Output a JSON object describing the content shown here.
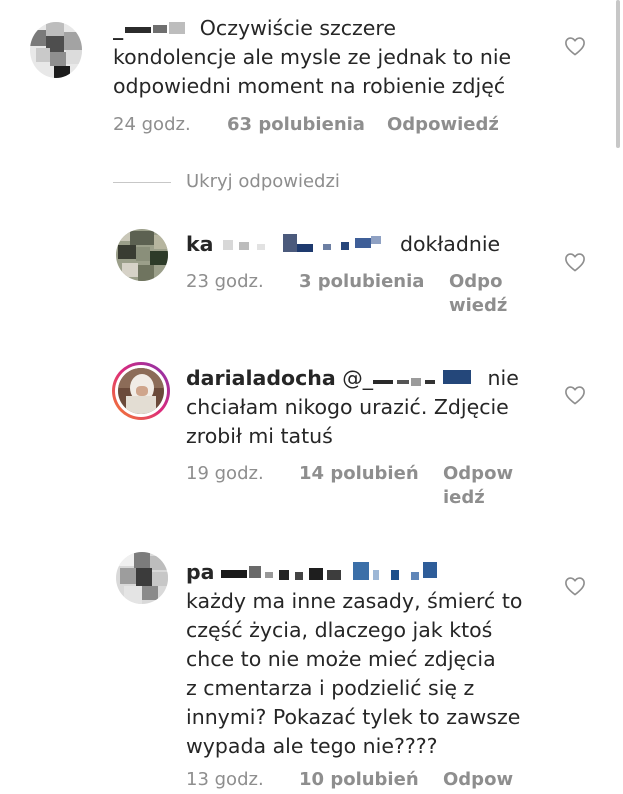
{
  "comments": [
    {
      "username": "_",
      "text_lines": [
        "Oczywiście szczere",
        "kondolencje ale mysle ze jednak to nie",
        "odpowiedni moment na robienie zdjęć"
      ],
      "time": "24 godz.",
      "likes": "63 polubienia",
      "reply_label": "Odpowiedź"
    },
    {
      "username": "ka",
      "text": "dokładnie",
      "time": "23 godz.",
      "likes": "3 polubienia",
      "reply_line1": "Odpo",
      "reply_line2": "wiedź"
    },
    {
      "username": "darialadocha",
      "mention": "@_",
      "text_line1_end": "nie",
      "text_line2": "chciałam nikogo urazić. Zdjęcie",
      "text_line3": "zrobił mi tatuś",
      "time": "19 godz.",
      "likes": "14 polubień",
      "reply_line1": "Odpow",
      "reply_line2": "iedź"
    },
    {
      "username": "pa",
      "text_lines": [
        "każdy ma inne zasady, śmierć to",
        "część życia, dlaczego jak ktoś",
        "chce to nie może mieć zdjęcia",
        "z cmentarza i podzielić się z",
        "innymi? Pokazać tylek to zawsze",
        "wypada ale tego nie????"
      ],
      "time": "13 godz.",
      "likes": "10 polubień",
      "reply_line1": "Odpow"
    }
  ],
  "hide_replies_label": "Ukryj odpowiedzi",
  "colors": {
    "text": "#262626",
    "meta": "#8e8e8e",
    "divider": "#c7c7c7"
  },
  "icons": {
    "like": "heart-outline-icon"
  }
}
